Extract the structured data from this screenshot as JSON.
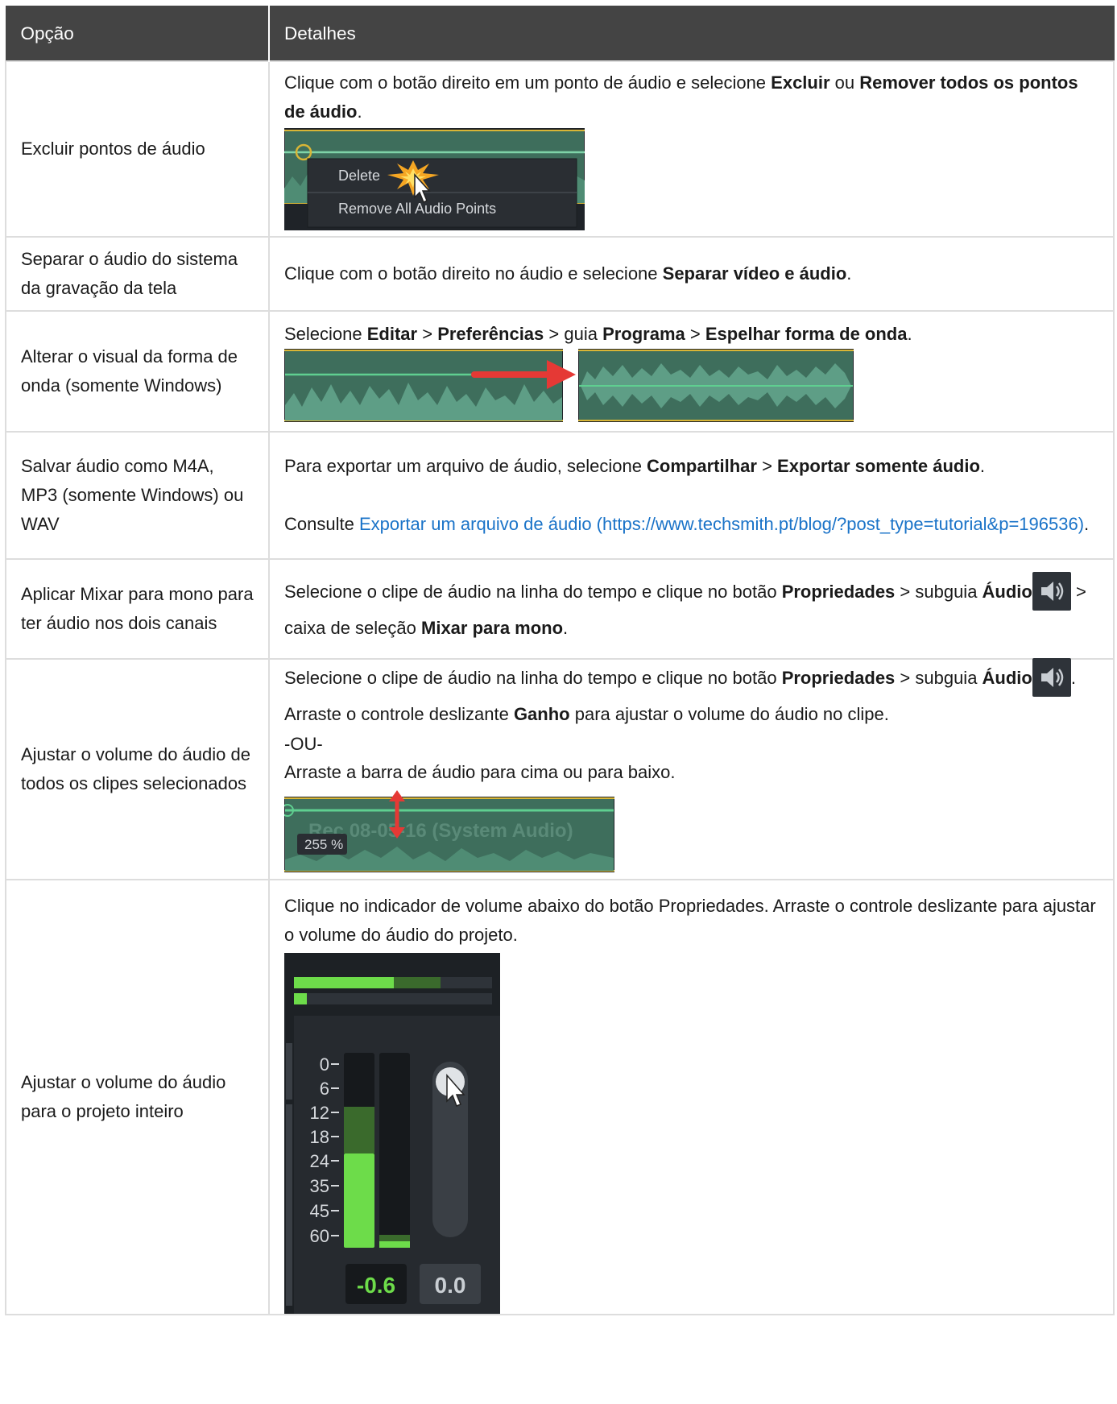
{
  "header": {
    "col1": "Opção",
    "col2": "Detalhes"
  },
  "rows": [
    {
      "option": "Excluir pontos de áudio",
      "d1": "Clique com o botão direito em um ponto de áudio e selecione ",
      "b1": "Excluir",
      "d2": " ou ",
      "b2": "Remover todos os pontos de áudio",
      "d3": ".",
      "menu_item_1": "Delete",
      "menu_item_2": "Remove All Audio Points"
    },
    {
      "option": "Separar o áudio do sistema da gravação da tela",
      "d1": "Clique com o botão direito no áudio e selecione ",
      "b1": "Separar vídeo e áudio",
      "d2": "."
    },
    {
      "option": "Alterar o visual da forma de onda (somente Windows)",
      "d1": "Selecione ",
      "b1": "Editar",
      "d2": " > ",
      "b2": "Preferências",
      "d3": " > guia ",
      "b3": "Programa",
      "d4": " > ",
      "b4": "Espelhar forma de onda",
      "d5": "."
    },
    {
      "option": "Salvar áudio como M4A, MP3 (somente Windows) ou WAV",
      "d1": "Para exportar um arquivo de áudio, selecione ",
      "b1": "Compartilhar",
      "d2": " > ",
      "b2": "Exportar somente áudio",
      "d3": ".",
      "d4": "Consulte ",
      "link": "Exportar um arquivo de áudio (https://www.techsmith.pt/blog/?post_type=tutorial&p=196536)",
      "d5": "."
    },
    {
      "option": "Aplicar Mixar para mono para ter áudio nos dois canais",
      "d1": "Selecione o clipe de áudio na linha do tempo e clique no botão ",
      "b1": "Propriedades",
      "d2": " > subguia ",
      "b2": "Áudio",
      "d3": " > caixa de seleção ",
      "b3": "Mixar para mono",
      "d4": "."
    },
    {
      "option": "Ajustar o volume do áudio de todos os clipes selecionados",
      "d1": "Selecione o clipe de áudio na linha do tempo e clique no botão ",
      "b1": "Propriedades",
      "d2": " > subguia ",
      "b2": "Áudio",
      "d3": ". Arraste o controle deslizante ",
      "b3": "Ganho",
      "d4": " para ajustar o volume do áudio no clipe.",
      "or": "-OU-",
      "d5": "Arraste a barra de áudio para cima ou para baixo.",
      "clip_label": "Rec 08-05-16 (System Audio)",
      "gain_badge": "255 %"
    },
    {
      "option": "Ajustar o volume do áudio para o projeto inteiro",
      "d1": "Clique no indicador de volume abaixo do botão Propriedades. Arraste o controle deslizante para ajustar o volume do áudio do projeto.",
      "meter_ticks": [
        "0",
        "6",
        "12",
        "18",
        "24",
        "35",
        "45",
        "60"
      ],
      "meter_level": "-0.6",
      "slider_value": "0.0"
    }
  ],
  "colors": {
    "header_bg": "#444444",
    "link": "#1a73c8",
    "timeline_green": "#4a8a70",
    "arrow_red": "#e53935",
    "meter_green": "#6ddc4a"
  }
}
